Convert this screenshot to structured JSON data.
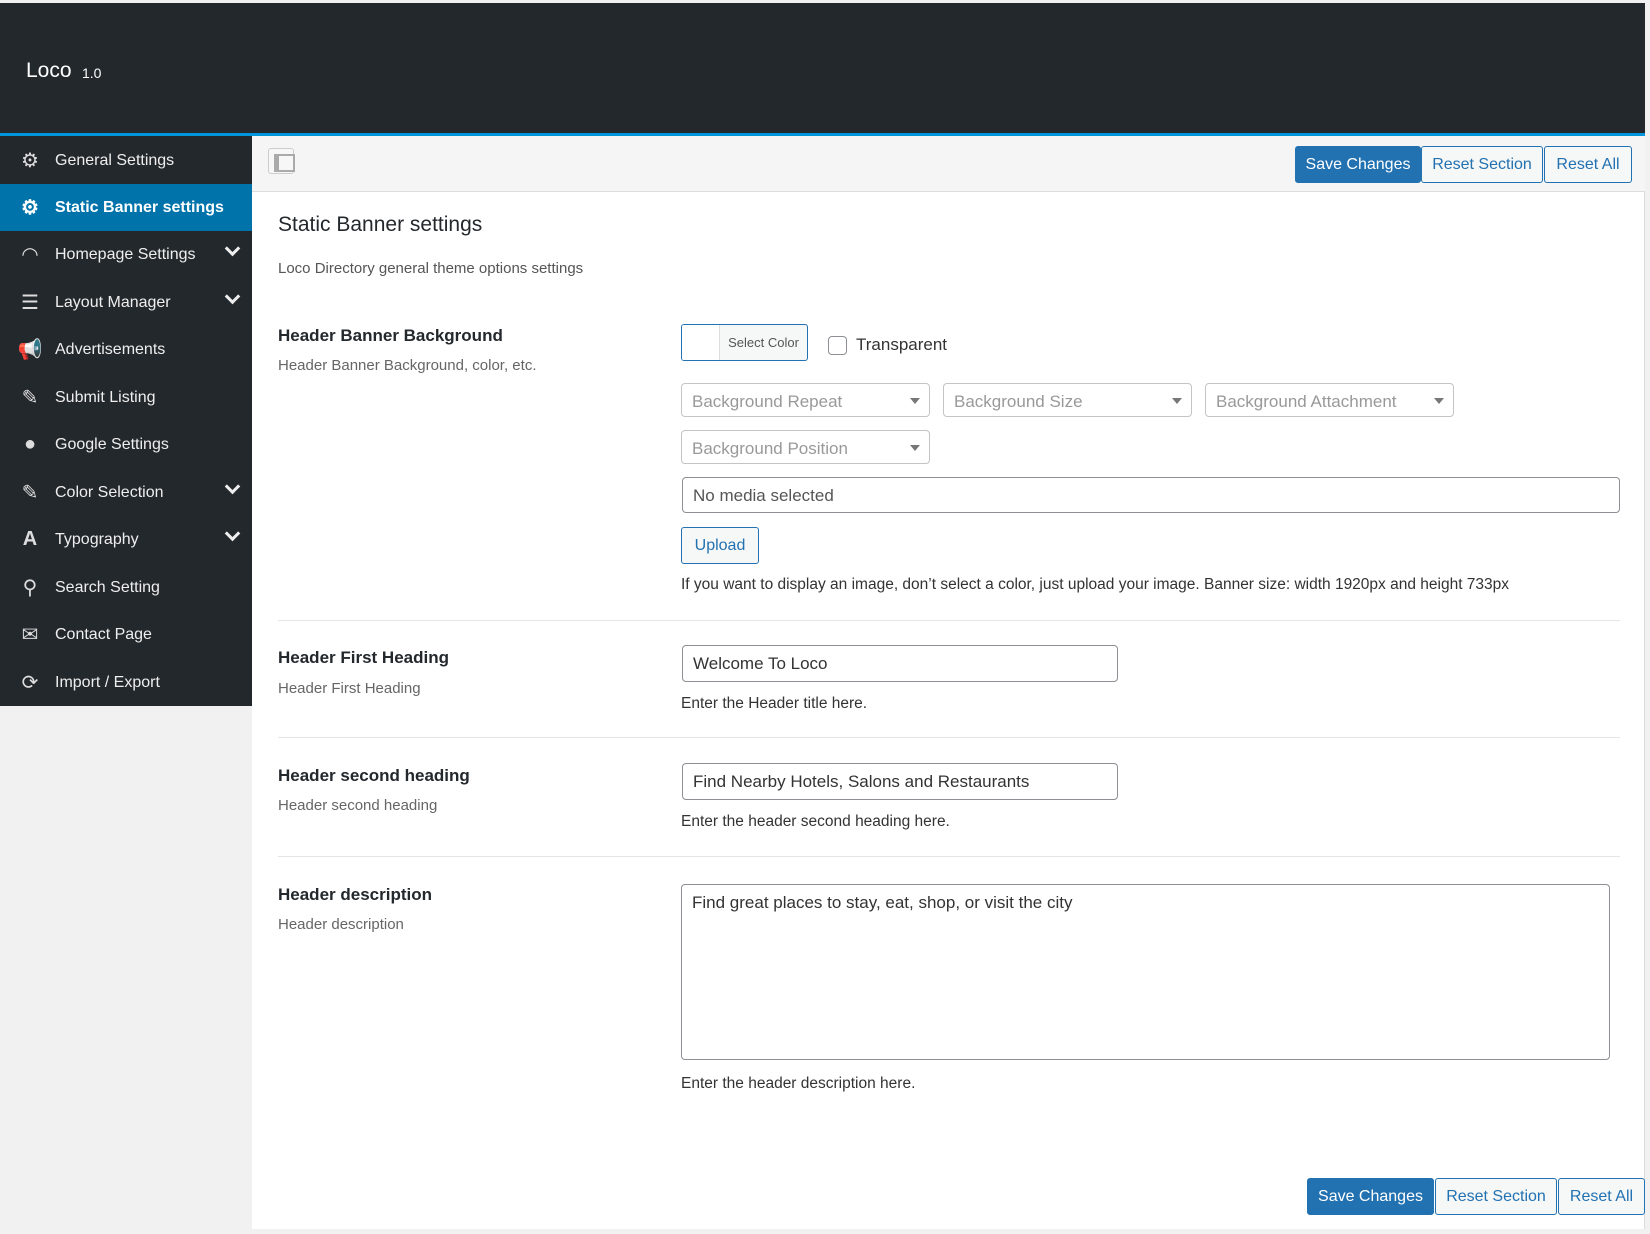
{
  "app": {
    "title": "Loco",
    "version": "1.0"
  },
  "sidebar": {
    "items": [
      {
        "label": "General Settings",
        "icon": "gear-icon"
      },
      {
        "label": "Static Banner settings",
        "icon": "gear-icon",
        "active": true
      },
      {
        "label": "Homepage Settings",
        "icon": "dashboard-icon",
        "expandable": true
      },
      {
        "label": "Layout Manager",
        "icon": "list-icon",
        "expandable": true
      },
      {
        "label": "Advertisements",
        "icon": "megaphone-icon"
      },
      {
        "label": "Submit Listing",
        "icon": "brush-icon"
      },
      {
        "label": "Google Settings",
        "icon": "location-pin-icon"
      },
      {
        "label": "Color Selection",
        "icon": "brush-icon",
        "expandable": true
      },
      {
        "label": "Typography",
        "icon": "font-icon",
        "expandable": true
      },
      {
        "label": "Search Setting",
        "icon": "search-icon"
      },
      {
        "label": "Contact Page",
        "icon": "envelope-icon"
      },
      {
        "label": "Import / Export",
        "icon": "refresh-icon"
      }
    ]
  },
  "toolbar": {
    "save": "Save Changes",
    "reset_section": "Reset Section",
    "reset_all": "Reset All"
  },
  "section": {
    "title": "Static Banner settings",
    "description": "Loco Directory general theme options settings"
  },
  "fields": {
    "banner_bg": {
      "label": "Header Banner Background",
      "sub": "Header Banner Background, color, etc.",
      "select_color": "Select Color",
      "transparent": "Transparent",
      "repeat": "Background Repeat",
      "size": "Background Size",
      "attachment": "Background Attachment",
      "position": "Background Position",
      "media": "No media selected",
      "upload": "Upload",
      "help": "If you want to display an image, don’t select a color, just upload your image. Banner size: width 1920px and height 733px"
    },
    "first_heading": {
      "label": "Header First Heading",
      "sub": "Header First Heading",
      "value": "Welcome To Loco",
      "help": "Enter the Header title here."
    },
    "second_heading": {
      "label": "Header second heading",
      "sub": "Header second heading",
      "value": "Find Nearby Hotels, Salons and Restaurants",
      "help": "Enter the header second heading here."
    },
    "description": {
      "label": "Header description",
      "sub": "Header description",
      "value": "Find great places to stay, eat, shop, or visit the city",
      "help": "Enter the header description here."
    }
  },
  "colors": {
    "header": "#23282d",
    "accent": "#0073aa",
    "primary_button": "#2271b1"
  }
}
